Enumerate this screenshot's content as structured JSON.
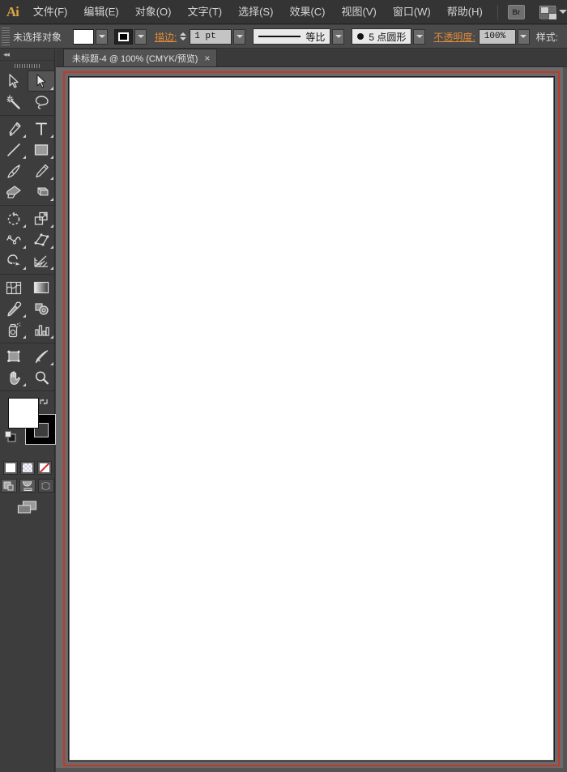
{
  "app": {
    "name": "Adobe Illustrator",
    "logo_text": "Ai",
    "accent_orange": "#e08b3a",
    "artboard_border_color": "#c0392b",
    "chrome_bg": "#3d3d3d",
    "canvas_bg": "#6a6a6a"
  },
  "menubar": {
    "items": [
      {
        "label": "文件(F)",
        "name": "menu-file"
      },
      {
        "label": "编辑(E)",
        "name": "menu-edit"
      },
      {
        "label": "对象(O)",
        "name": "menu-object"
      },
      {
        "label": "文字(T)",
        "name": "menu-type"
      },
      {
        "label": "选择(S)",
        "name": "menu-select"
      },
      {
        "label": "效果(C)",
        "name": "menu-effect"
      },
      {
        "label": "视图(V)",
        "name": "menu-view"
      },
      {
        "label": "窗口(W)",
        "name": "menu-window"
      },
      {
        "label": "帮助(H)",
        "name": "menu-help"
      }
    ],
    "bridge_label": "Br",
    "workspace_icon": "workspace-switcher-icon"
  },
  "controlbar": {
    "selection_status": "未选择对象",
    "fill_swatch_label": "fill-swatch",
    "stroke_swatch_label": "stroke-swatch",
    "stroke_label": "描边:",
    "stroke_weight": "1 pt",
    "stroke_profile": "等比",
    "brush_definition": "5 点圆形",
    "opacity_label": "不透明度:",
    "opacity_value": "100%",
    "style_label": "样式:"
  },
  "tabbar": {
    "tabs": [
      {
        "title": "未标题-4 @ 100% (CMYK/预览)",
        "close": "×",
        "active": true
      }
    ]
  },
  "toolbar": {
    "collapse_label": "◂◂",
    "tools": [
      {
        "name": "selection-tool",
        "icon": "arrow-black",
        "selected": false,
        "hasflyout": false
      },
      {
        "name": "direct-selection-tool",
        "icon": "arrow-white",
        "selected": true,
        "hasflyout": true
      },
      {
        "name": "magic-wand-tool",
        "icon": "magic-wand",
        "selected": false,
        "hasflyout": false
      },
      {
        "name": "lasso-tool",
        "icon": "lasso",
        "selected": false,
        "hasflyout": false
      },
      {
        "name": "pen-tool",
        "icon": "pen",
        "selected": false,
        "hasflyout": true
      },
      {
        "name": "type-tool",
        "icon": "type-T",
        "selected": false,
        "hasflyout": true
      },
      {
        "name": "line-segment-tool",
        "icon": "line-segment",
        "selected": false,
        "hasflyout": true
      },
      {
        "name": "rectangle-tool",
        "icon": "rectangle",
        "selected": false,
        "hasflyout": true
      },
      {
        "name": "paintbrush-tool",
        "icon": "paintbrush",
        "selected": false,
        "hasflyout": false
      },
      {
        "name": "pencil-tool",
        "icon": "pencil",
        "selected": false,
        "hasflyout": true
      },
      {
        "name": "blob-brush-tool",
        "icon": "blob-brush",
        "selected": false,
        "hasflyout": false
      },
      {
        "name": "eraser-tool",
        "icon": "eraser",
        "selected": false,
        "hasflyout": true
      },
      {
        "name": "rotate-tool",
        "icon": "rotate",
        "selected": false,
        "hasflyout": true
      },
      {
        "name": "scale-tool",
        "icon": "scale",
        "selected": false,
        "hasflyout": true
      },
      {
        "name": "width-tool",
        "icon": "width-warp",
        "selected": false,
        "hasflyout": true
      },
      {
        "name": "free-transform-tool",
        "icon": "free-transform",
        "selected": false,
        "hasflyout": true
      },
      {
        "name": "shape-builder-tool",
        "icon": "shape-builder",
        "selected": false,
        "hasflyout": true
      },
      {
        "name": "perspective-grid-tool",
        "icon": "perspective-grid",
        "selected": false,
        "hasflyout": true
      },
      {
        "name": "mesh-tool",
        "icon": "mesh",
        "selected": false,
        "hasflyout": false
      },
      {
        "name": "gradient-tool",
        "icon": "gradient",
        "selected": false,
        "hasflyout": false
      },
      {
        "name": "eyedropper-tool",
        "icon": "eyedropper",
        "selected": false,
        "hasflyout": true
      },
      {
        "name": "blend-tool",
        "icon": "blend",
        "selected": false,
        "hasflyout": false
      },
      {
        "name": "symbol-sprayer-tool",
        "icon": "symbol-sprayer",
        "selected": false,
        "hasflyout": true
      },
      {
        "name": "column-graph-tool",
        "icon": "column-graph",
        "selected": false,
        "hasflyout": true
      },
      {
        "name": "artboard-tool",
        "icon": "artboard",
        "selected": false,
        "hasflyout": false
      },
      {
        "name": "slice-tool",
        "icon": "slice",
        "selected": false,
        "hasflyout": true
      },
      {
        "name": "hand-tool",
        "icon": "hand",
        "selected": false,
        "hasflyout": true
      },
      {
        "name": "zoom-tool",
        "icon": "magnifier",
        "selected": false,
        "hasflyout": false
      }
    ],
    "fill_color": "#ffffff",
    "stroke_color": "#000000",
    "fill_stroke": {
      "fill_name": "fill-color-swatch",
      "stroke_name": "stroke-color-swatch",
      "swap_name": "swap-fill-stroke-icon",
      "default_name": "default-fill-stroke-icon"
    },
    "color_modes": [
      {
        "name": "color-mode-solid",
        "icon": "solid-color-icon"
      },
      {
        "name": "color-mode-gradient",
        "icon": "gradient-icon"
      },
      {
        "name": "color-mode-none",
        "icon": "none-color-icon"
      }
    ],
    "draw_modes": [
      {
        "name": "draw-normal-mode",
        "icon": "draw-normal-icon",
        "active": true
      },
      {
        "name": "draw-behind-mode",
        "icon": "draw-behind-icon",
        "active": true
      },
      {
        "name": "draw-inside-mode",
        "icon": "draw-inside-icon",
        "active": false
      }
    ],
    "screen_mode": {
      "name": "change-screen-mode",
      "icon": "screen-mode-icon"
    }
  }
}
